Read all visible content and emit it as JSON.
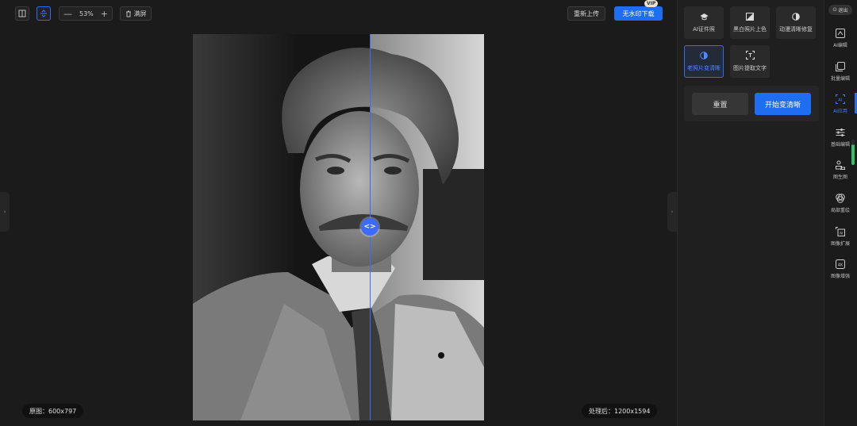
{
  "toolbar": {
    "zoom_value": "53%",
    "zoom_minus": "—",
    "zoom_plus": "+",
    "fullscreen_label": "满屏",
    "reupload_label": "重新上传",
    "download_label": "无水印下载",
    "vip_label": "VIP",
    "icons": [
      "split-view-icon",
      "compare-icon",
      "trash-icon"
    ]
  },
  "canvas": {
    "original_size_label": "原图：600x797",
    "processed_size_label": "处理后：1200x1594",
    "slider_icon": "<>",
    "accent_color": "#3d6bff"
  },
  "tools": [
    {
      "label": "AI证件照",
      "icon": "graduation-cap-icon",
      "active": false
    },
    {
      "label": "黑白照片上色",
      "icon": "colorize-icon",
      "active": false
    },
    {
      "label": "动漫清晰修复",
      "icon": "contrast-icon",
      "active": false
    },
    {
      "label": "老照片变清晰",
      "icon": "restore-icon",
      "active": true
    },
    {
      "label": "图片提取文字",
      "icon": "text-scan-icon",
      "active": false
    }
  ],
  "actions": {
    "reset_label": "重置",
    "start_label": "开始变清晰"
  },
  "nav": {
    "logout_label": "退出",
    "items": [
      {
        "label": "AI编辑",
        "icon": "ai-edit-icon",
        "active": false
      },
      {
        "label": "批量编辑",
        "icon": "batch-edit-icon",
        "active": false
      },
      {
        "label": "AI应用",
        "icon": "ai-app-icon",
        "active": true
      },
      {
        "label": "基础编辑",
        "icon": "sliders-icon",
        "active": false
      },
      {
        "label": "图生图",
        "icon": "image-to-image-icon",
        "active": false
      },
      {
        "label": "局部重绘",
        "icon": "inpaint-icon",
        "active": false
      },
      {
        "label": "图像扩展",
        "icon": "expand-icon",
        "active": false
      },
      {
        "label": "图像增强",
        "icon": "enhance-4k-icon",
        "active": false
      }
    ]
  },
  "colors": {
    "primary": "#1f6df0",
    "background": "#1b1b1b",
    "panel": "#1f1f1f"
  }
}
